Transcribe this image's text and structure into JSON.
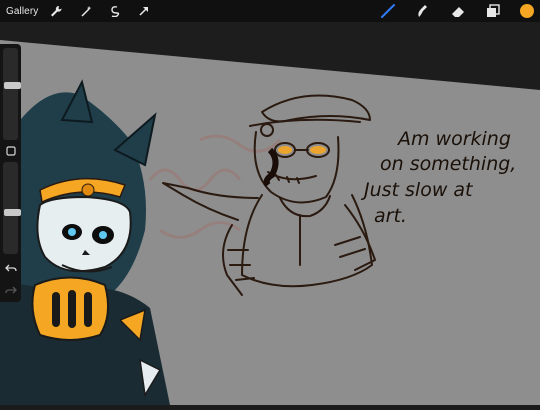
{
  "app": {
    "name": "Procreate"
  },
  "topbar": {
    "gallery_label": "Gallery",
    "left_tools": [
      "wrench-icon",
      "magic-wand-icon",
      "selection-icon",
      "transform-arrow-icon"
    ],
    "right_tools": [
      "brush-icon",
      "smudge-icon",
      "eraser-icon",
      "layers-icon",
      "color-swatch"
    ],
    "active_tool": "brush-icon",
    "accent_color": "#2f7bf6",
    "current_color": "#f5a623"
  },
  "sidebar": {
    "brush_size_level": 0.6,
    "opacity_level": 0.45,
    "modify_button_icon": "square-modify-icon",
    "undo_icon": "undo-arrow-icon",
    "redo_icon": "redo-arrow-icon"
  },
  "canvas": {
    "background_color": "#8e8e8e",
    "handwritten_note": [
      "Am working",
      "on something,",
      "Just slow at",
      "art."
    ],
    "stroke_color": "#2a1a10"
  }
}
